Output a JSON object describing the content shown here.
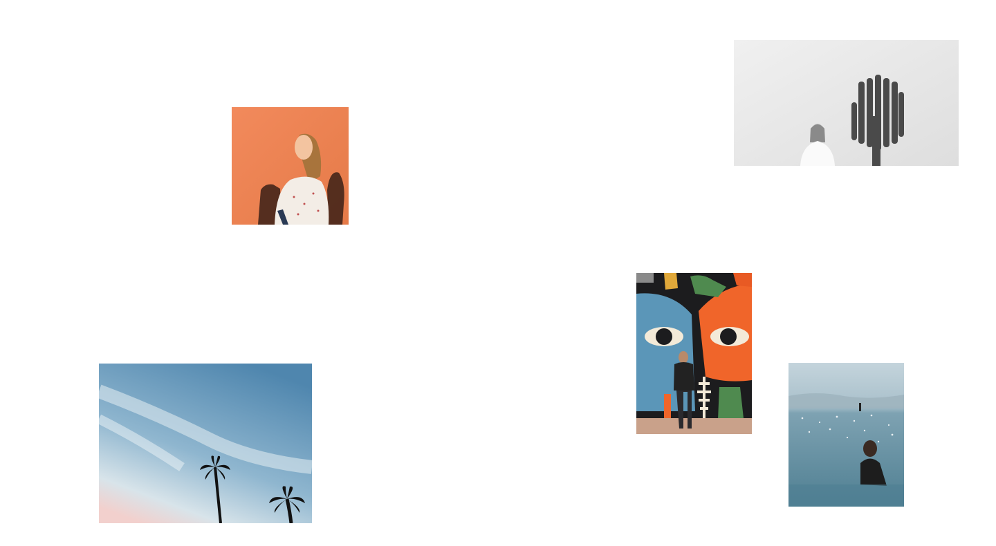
{
  "colors": {
    "background": "#ffffff",
    "orange_wall": "#f0875a",
    "cactus_wall": "#e8e8e8",
    "mural_blue": "#5b96b8",
    "mural_orange": "#f0652a",
    "sky_top": "#5a8fb5",
    "sky_bottom": "#f1d3d0",
    "sea": "#5d8ea1"
  },
  "photos": [
    {
      "name": "woman-orange-wall-photo",
      "icon": "portrait-photo"
    },
    {
      "name": "woman-cactus-wall-photo",
      "icon": "cactus-photo"
    },
    {
      "name": "woman-mural-photo",
      "icon": "mural-photo"
    },
    {
      "name": "palm-trees-sky-photo",
      "icon": "palm-tree-photo"
    },
    {
      "name": "woman-in-sea-photo",
      "icon": "sea-photo"
    }
  ]
}
